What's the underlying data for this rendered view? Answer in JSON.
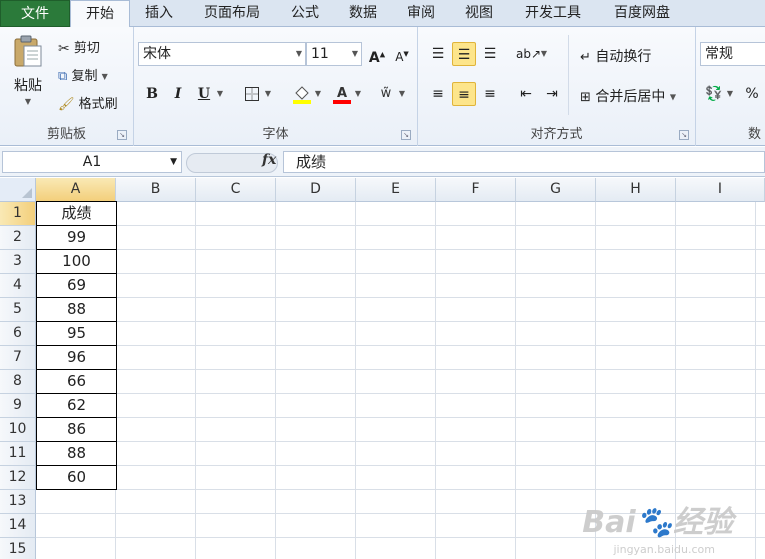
{
  "tabs": [
    "文件",
    "开始",
    "插入",
    "页面布局",
    "公式",
    "数据",
    "审阅",
    "视图",
    "开发工具",
    "百度网盘"
  ],
  "clipboard": {
    "paste_label": "粘贴",
    "cut_label": "剪切",
    "copy_label": "复制",
    "format_painter_label": "格式刷",
    "group_label": "剪贴板"
  },
  "font": {
    "font_name": "宋体",
    "font_size": "11",
    "bold_label": "B",
    "italic_label": "I",
    "underline_label": "U",
    "group_label": "字体",
    "fill_color": "#ffff00",
    "font_color": "#ff0000"
  },
  "alignment": {
    "wrap_text_label": "自动换行",
    "merge_center_label": "合并后居中",
    "group_label": "对齐方式"
  },
  "number": {
    "format_value": "常规",
    "percent_label": "%",
    "group_label": "数"
  },
  "formula_bar": {
    "name_box": "A1",
    "fx_label": "fx",
    "content": "成绩"
  },
  "columns": [
    "A",
    "B",
    "C",
    "D",
    "E",
    "F",
    "G",
    "H",
    "I"
  ],
  "rows": [
    "1",
    "2",
    "3",
    "4",
    "5",
    "6",
    "7",
    "8",
    "9",
    "10",
    "11",
    "12",
    "13",
    "14",
    "15"
  ],
  "cells_A": [
    "成绩",
    "99",
    "100",
    "69",
    "88",
    "95",
    "96",
    "66",
    "62",
    "86",
    "88",
    "60"
  ],
  "watermark": {
    "text": "Bai🐾经验",
    "url": "jingyan.baidu.com"
  }
}
